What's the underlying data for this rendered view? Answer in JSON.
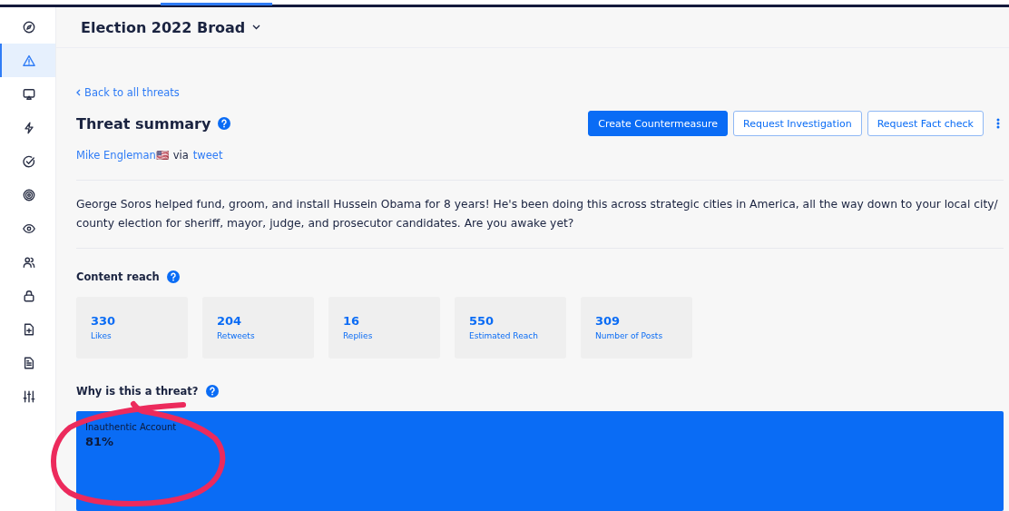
{
  "sidebar": {
    "items": [
      {
        "selected": false
      },
      {
        "selected": true
      },
      {
        "selected": false
      },
      {
        "selected": false
      },
      {
        "selected": false
      },
      {
        "selected": false
      },
      {
        "selected": false
      },
      {
        "selected": false
      },
      {
        "selected": false
      },
      {
        "selected": false
      },
      {
        "selected": false
      },
      {
        "selected": false
      }
    ]
  },
  "header": {
    "title": "Election 2022 Broad"
  },
  "back_link": "Back to all threats",
  "summary": {
    "title": "Threat summary",
    "author": "Mike Engleman🇺🇸",
    "via": "via",
    "source": "tweet",
    "buttons": [
      {
        "label": "Create Countermeasure",
        "kind": "primary"
      },
      {
        "label": "Request Investigation",
        "kind": "outline"
      },
      {
        "label": "Request Fact check",
        "kind": "outline"
      }
    ]
  },
  "post_text": "George Soros helped fund, groom, and install Hussein Obama for 8 years! He's been doing this across strategic cities in America, all the way down to your local city/county election for sheriff, mayor, judge, and prosecutor candidates. Are you awake yet?",
  "content_reach": {
    "title": "Content reach",
    "stats": [
      {
        "value": "330",
        "label": "Likes"
      },
      {
        "value": "204",
        "label": "Retweets"
      },
      {
        "value": "16",
        "label": "Replies"
      },
      {
        "value": "550",
        "label": "Estimated Reach"
      },
      {
        "value": "309",
        "label": "Number of Posts"
      }
    ]
  },
  "threat_reasons": {
    "title": "Why is this a threat?",
    "items": [
      {
        "label": "Inauthentic Account",
        "value": "81%"
      }
    ]
  }
}
